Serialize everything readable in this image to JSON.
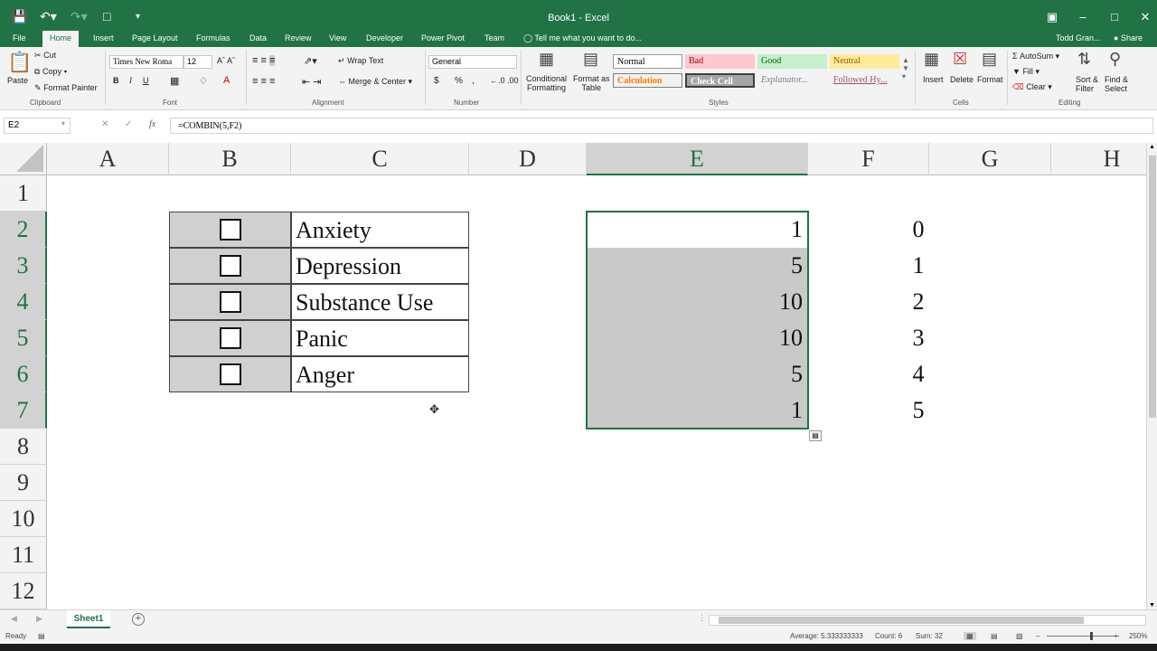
{
  "window": {
    "title": "Book1 - Excel",
    "qat_icons": [
      "save-icon",
      "undo-icon",
      "redo-icon",
      "new-doc-icon",
      "customize-icon"
    ],
    "controls": [
      "ribbon-display-icon",
      "minimize-icon",
      "restore-icon",
      "close-icon"
    ]
  },
  "tabs": {
    "file": "File",
    "home": "Home",
    "insert": "Insert",
    "page_layout": "Page Layout",
    "formulas": "Formulas",
    "data": "Data",
    "review": "Review",
    "view": "View",
    "developer": "Developer",
    "power_pivot": "Power Pivot",
    "team": "Team",
    "tell_me": "Tell me what you want to do...",
    "user": "Todd Gran...",
    "share": "Share"
  },
  "ribbon": {
    "clipboard": {
      "paste": "Paste",
      "cut": "Cut",
      "copy": "Copy",
      "format_painter": "Format Painter",
      "label": "Clipboard"
    },
    "font": {
      "name": "Times New Roma",
      "size": "12",
      "bold": "B",
      "italic": "I",
      "underline": "U",
      "label": "Font"
    },
    "alignment": {
      "wrap": "Wrap Text",
      "merge": "Merge & Center",
      "label": "Alignment"
    },
    "number": {
      "format": "General",
      "currency": "$",
      "percent": "%",
      "comma": ",",
      "label": "Number"
    },
    "styles": {
      "conditional": "Conditional",
      "conditional2": "Formatting",
      "format_as": "Format as",
      "format_as2": "Table",
      "normal": "Normal",
      "bad": "Bad",
      "good": "Good",
      "neutral": "Neutral",
      "calculation": "Calculation",
      "check_cell": "Check Cell",
      "explanatory": "Explanator...",
      "followed": "Followed Hy...",
      "label": "Styles",
      "colors": {
        "bad_bg": "#ffc7ce",
        "bad_fg": "#9c0006",
        "good_bg": "#c6efce",
        "good_fg": "#006100",
        "neutral_bg": "#ffeb9c",
        "neutral_fg": "#9c5700",
        "calc_fg": "#fa7d00",
        "check_bg": "#a5a5a5"
      }
    },
    "cells": {
      "insert": "Insert",
      "delete": "Delete",
      "format": "Format",
      "label": "Cells"
    },
    "editing": {
      "autosum": "AutoSum",
      "fill": "Fill",
      "clear": "Clear",
      "sort": "Sort &",
      "sort2": "Filter",
      "find": "Find &",
      "find2": "Select",
      "label": "Editing"
    }
  },
  "formula_bar": {
    "name_box": "E2",
    "formula": "=COMBIN(5,F2)"
  },
  "sheet": {
    "columns": [
      "A",
      "B",
      "C",
      "D",
      "E",
      "F",
      "G",
      "H"
    ],
    "rows": [
      "1",
      "2",
      "3",
      "4",
      "5",
      "6",
      "7",
      "8",
      "9",
      "10",
      "11",
      "12"
    ],
    "selected_column": "E",
    "checklist": [
      "Anxiety",
      "Depression",
      "Substance Use",
      "Panic",
      "Anger"
    ],
    "e_values": [
      "1",
      "5",
      "10",
      "10",
      "5",
      "1"
    ],
    "f_values": [
      "0",
      "1",
      "2",
      "3",
      "4",
      "5"
    ]
  },
  "sheet_tabs": {
    "active": "Sheet1"
  },
  "status": {
    "ready": "Ready",
    "average": "Average: 5.333333333",
    "count": "Count: 6",
    "sum": "Sum: 32",
    "zoom": "250%"
  },
  "accent": "#217346"
}
